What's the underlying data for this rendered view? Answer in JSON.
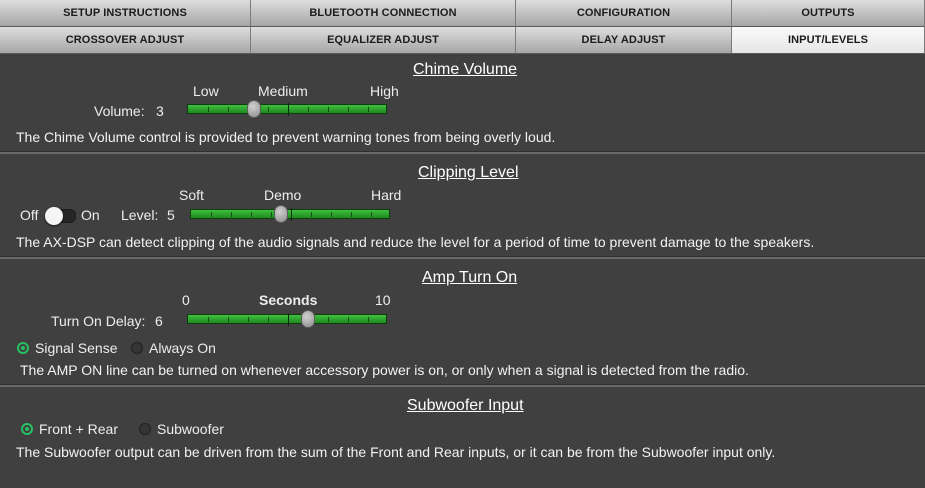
{
  "tabs": {
    "row1": [
      "SETUP INSTRUCTIONS",
      "BLUETOOTH CONNECTION",
      "CONFIGURATION",
      "OUTPUTS"
    ],
    "row2": [
      "CROSSOVER ADJUST",
      "EQUALIZER ADJUST",
      "DELAY ADJUST",
      "INPUT/LEVELS"
    ],
    "active": "INPUT/LEVELS"
  },
  "chime": {
    "title": "Chime Volume",
    "low": "Low",
    "medium": "Medium",
    "high": "High",
    "volume_label": "Volume:",
    "volume_value": "3",
    "slider_fraction": 0.33,
    "description": "The Chime Volume control is provided to prevent warning tones from being overly loud."
  },
  "clipping": {
    "title": "Clipping Level",
    "soft": "Soft",
    "demo": "Demo",
    "hard": "Hard",
    "off_label": "Off",
    "on_label": "On",
    "toggle_state": "off",
    "level_label": "Level:",
    "level_value": "5",
    "slider_fraction": 0.45,
    "description": "The AX-DSP can detect clipping of the audio signals and reduce the level for a period of time to prevent damage to the speakers."
  },
  "amp": {
    "title": "Amp Turn On",
    "min": "0",
    "unit": "Seconds",
    "max": "10",
    "delay_label": "Turn On Delay:",
    "delay_value": "6",
    "slider_fraction": 0.6,
    "option_signal": "Signal Sense",
    "option_always": "Always On",
    "selected": "Signal Sense",
    "description": "The AMP ON line can be turned on whenever accessory power is on, or only when a signal is detected from the radio."
  },
  "sub": {
    "title": "Subwoofer Input",
    "option_front_rear": "Front + Rear",
    "option_sub": "Subwoofer",
    "selected": "Front + Rear",
    "description": "The Subwoofer output can be driven from the sum of the Front and Rear inputs, or it can be from the Subwoofer input only."
  },
  "colors": {
    "background": "#404040",
    "slider_green": "#2ea32e",
    "radio_selected": "#27c061"
  }
}
